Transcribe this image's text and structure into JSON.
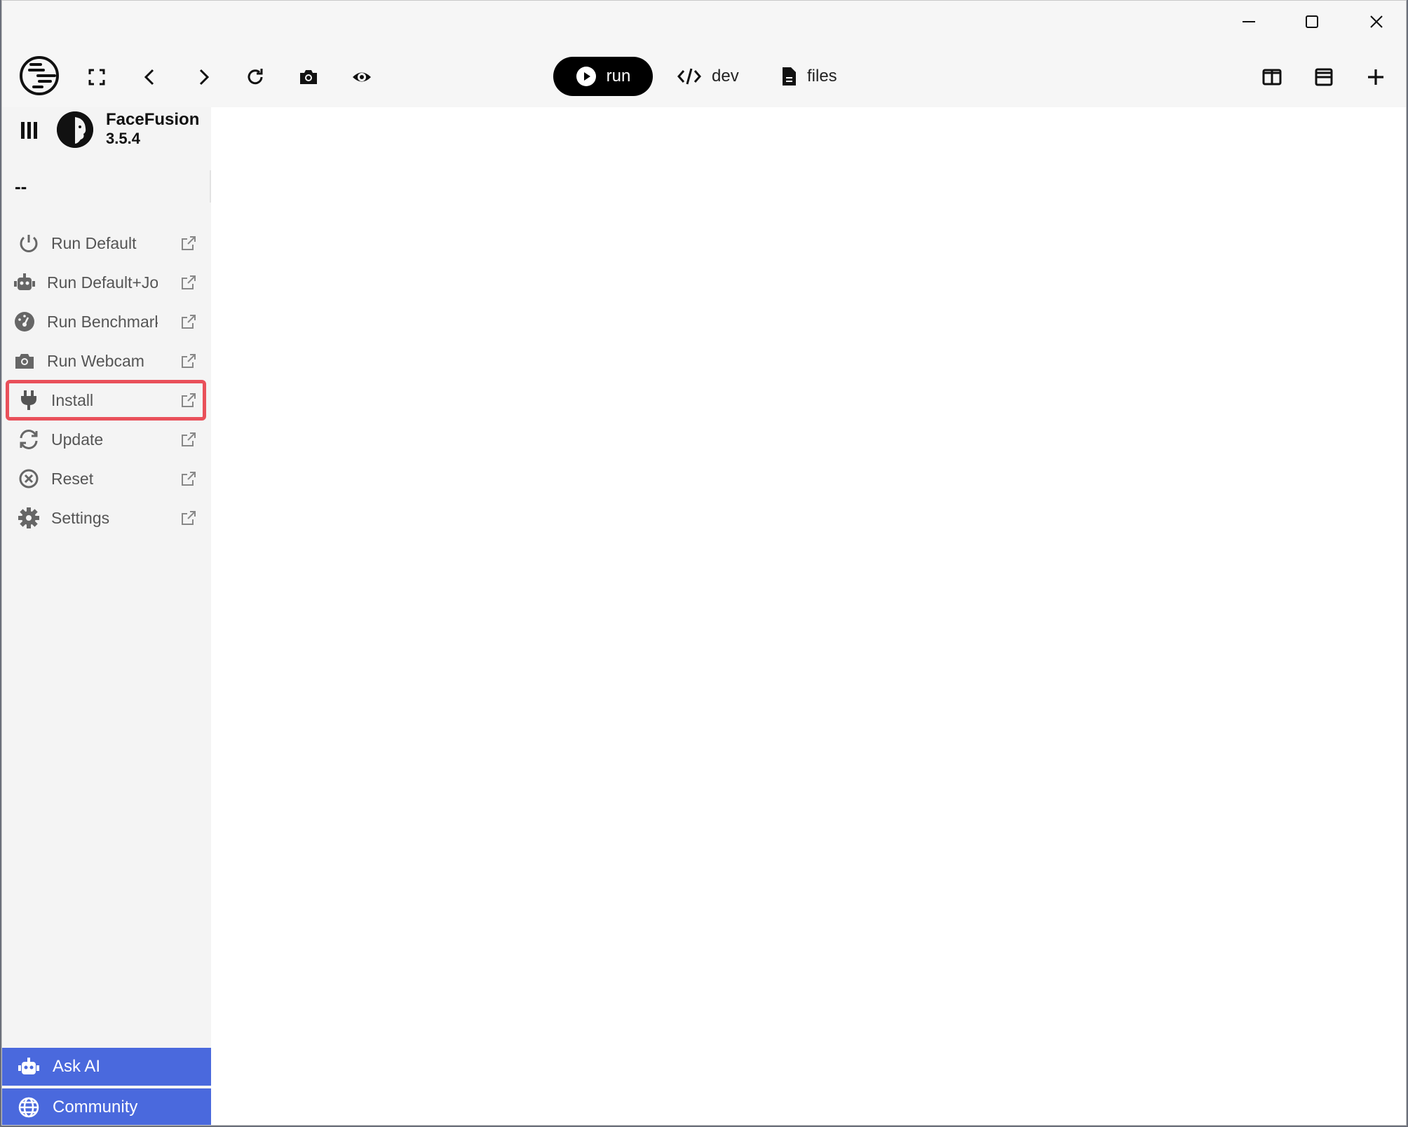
{
  "window": {
    "controls": [
      "minimize-icon",
      "maximize-icon",
      "close-icon"
    ]
  },
  "toolbar": {
    "left_icons": [
      "app-logo-icon",
      "fullscreen-icon",
      "back-icon",
      "forward-icon",
      "reload-icon",
      "screenshot-icon",
      "eye-icon"
    ],
    "tabs": {
      "run": "run",
      "dev": "dev",
      "files": "files"
    },
    "right_icons": [
      "split-vertical-icon",
      "split-horizontal-icon",
      "plus-icon"
    ]
  },
  "sidebar": {
    "app_name": "FaceFusion",
    "app_version": "3.5.4",
    "status": "--",
    "items": [
      {
        "label": "Run Default",
        "icon": "power-icon"
      },
      {
        "label": "Run Default+Jobs",
        "icon": "robot-icon"
      },
      {
        "label": "Run Benchmark",
        "icon": "gauge-icon"
      },
      {
        "label": "Run Webcam",
        "icon": "camera-icon"
      },
      {
        "label": "Install",
        "icon": "plug-icon"
      },
      {
        "label": "Update",
        "icon": "refresh-icon"
      },
      {
        "label": "Reset",
        "icon": "x-circle-icon"
      },
      {
        "label": "Settings",
        "icon": "gear-icon"
      }
    ],
    "selected_item": "Install",
    "ask_ai": "Ask AI",
    "community": "Community"
  },
  "colors": {
    "accent": "#4a69dd",
    "highlight": "#e9505a"
  }
}
